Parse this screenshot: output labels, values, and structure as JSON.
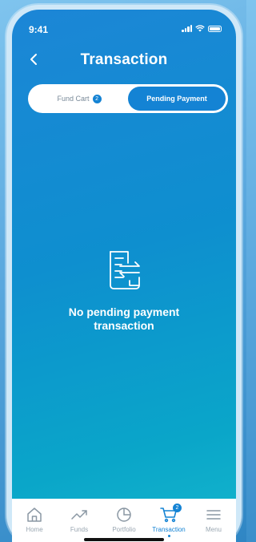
{
  "status_bar": {
    "time": "9:41"
  },
  "header": {
    "title": "Transaction"
  },
  "tabs": {
    "fund_cart": {
      "label": "Fund Cart",
      "badge": "2"
    },
    "pending_payment": {
      "label": "Pending Payment"
    }
  },
  "empty_state": {
    "message": "No pending payment transaction"
  },
  "bottom_nav": {
    "items": [
      {
        "label": "Home",
        "icon": "home-icon"
      },
      {
        "label": "Funds",
        "icon": "trending-up-icon"
      },
      {
        "label": "Portfolio",
        "icon": "pie-chart-icon"
      },
      {
        "label": "Transaction",
        "icon": "cart-icon",
        "badge": "2",
        "active": true
      },
      {
        "label": "Menu",
        "icon": "menu-icon"
      }
    ]
  },
  "colors": {
    "accent": "#1483d4",
    "background_top": "#1c86d6",
    "background_bottom": "#15b7cd"
  }
}
